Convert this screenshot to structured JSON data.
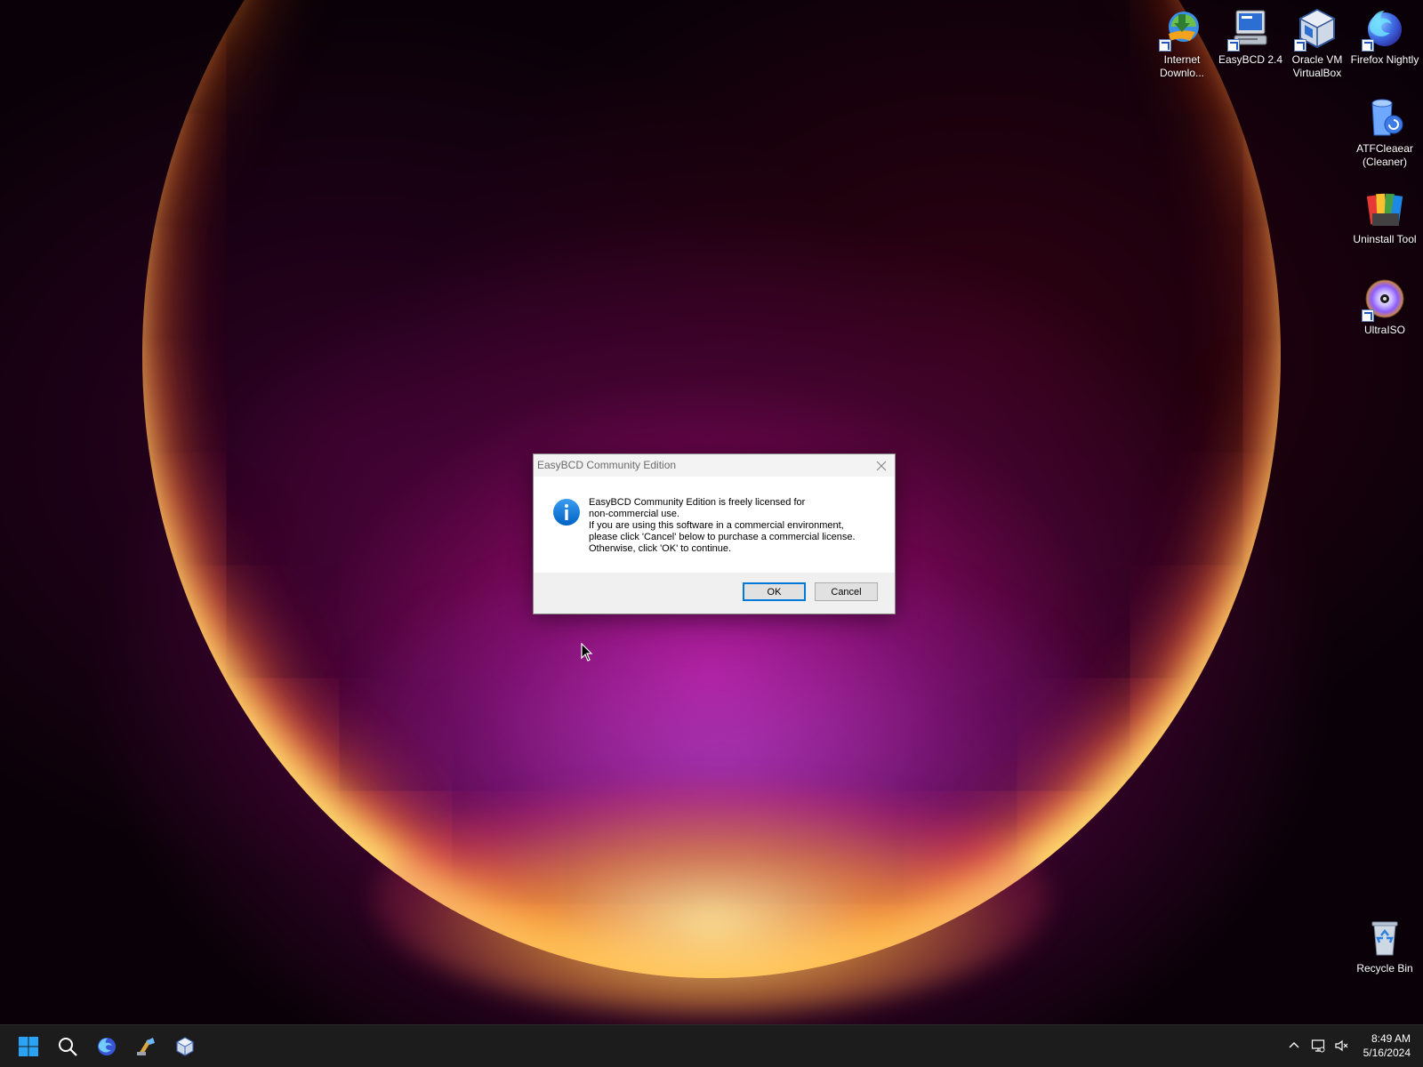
{
  "desktop": {
    "icons": [
      {
        "label": "Internet Downlo...",
        "icon": "internet-download-manager-icon"
      },
      {
        "label": "EasyBCD 2.4",
        "icon": "easybcd-icon"
      },
      {
        "label": "Oracle VM VirtualBox",
        "icon": "virtualbox-icon"
      },
      {
        "label": "Firefox Nightly",
        "icon": "firefox-nightly-icon"
      },
      {
        "label": "ATFCleaear (Cleaner)",
        "icon": "atf-cleaner-icon"
      },
      {
        "label": "Uninstall Tool",
        "icon": "uninstall-tool-icon"
      },
      {
        "label": "UltraISO",
        "icon": "ultraiso-icon"
      },
      {
        "label": "Recycle Bin",
        "icon": "recycle-bin-icon"
      }
    ]
  },
  "dialog": {
    "title": "EasyBCD Community Edition",
    "icon": "info-icon",
    "message_lines": [
      "EasyBCD Community Edition is freely licensed for",
      "non-commercial use.",
      "If you are using this software in a commercial environment,",
      "please click 'Cancel' below to purchase a commercial license.",
      "Otherwise, click 'OK' to continue."
    ],
    "ok_label": "OK",
    "cancel_label": "Cancel"
  },
  "taskbar": {
    "pinned": [
      "start-icon",
      "search-icon",
      "firefox-nightly-icon",
      "easybcd-icon",
      "virtualbox-icon"
    ],
    "tray": [
      "chevron-up-icon",
      "network-icon",
      "volume-muted-icon"
    ],
    "time": "8:49 AM",
    "date": "5/16/2024"
  },
  "colors": {
    "accent": "#0078d7",
    "taskbar": "#1c1c1c",
    "dialog_footer": "#f0f0f0"
  }
}
